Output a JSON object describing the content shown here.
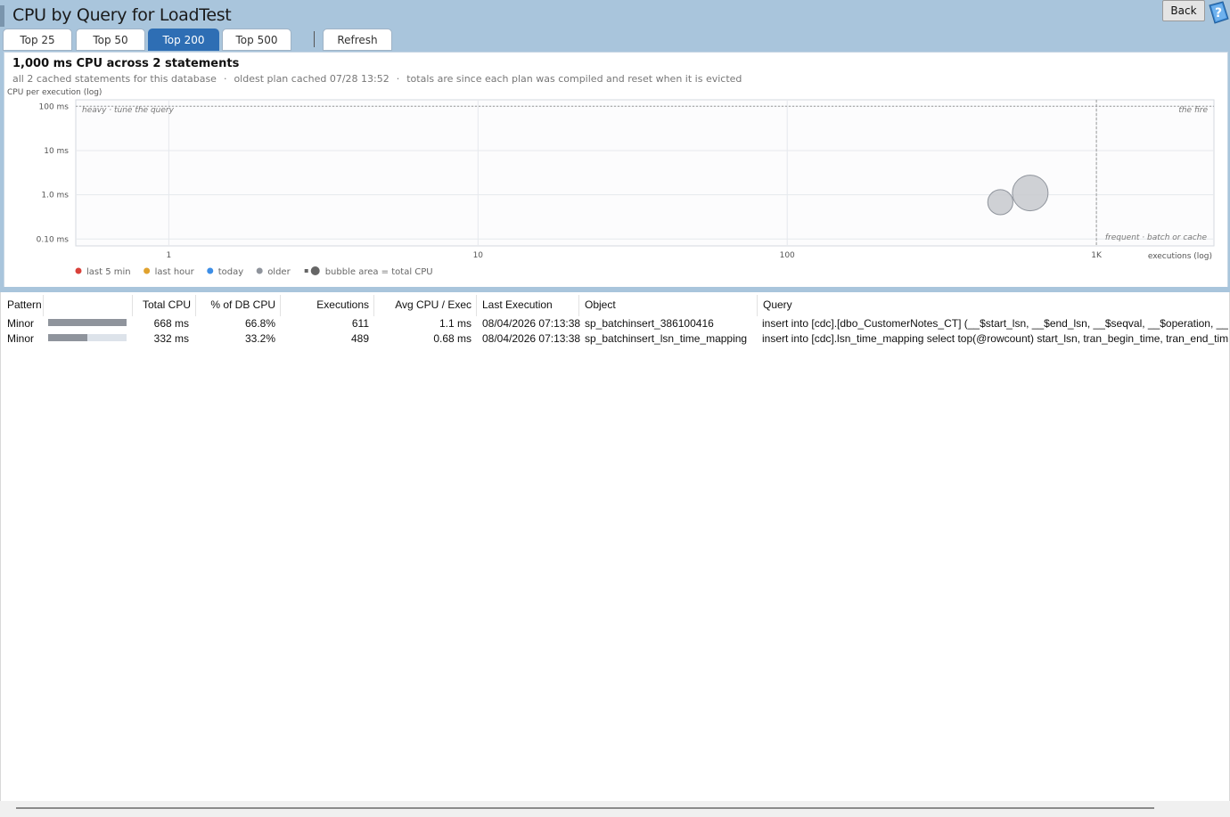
{
  "header": {
    "title": "CPU by Query for LoadTest",
    "back_label": "Back",
    "tabs": [
      {
        "label": "Top 25",
        "active": false
      },
      {
        "label": "Top 50",
        "active": false
      },
      {
        "label": "Top 200",
        "active": true
      },
      {
        "label": "Top 500",
        "active": false
      }
    ],
    "refresh_label": "Refresh"
  },
  "summary": {
    "headline": "1,000 ms CPU across 2 statements",
    "sub_1": "all 2 cached statements for this database",
    "sub_2": "oldest plan cached 07/28 13:52",
    "sub_3": "totals are since each plan was compiled and reset when it is evicted",
    "separator": "·"
  },
  "chart_data": {
    "type": "scatter",
    "ylabel": "CPU per execution (log)",
    "xlabel": "executions (log)",
    "x_scale": "log",
    "y_scale": "log",
    "xlim": [
      0.5,
      2400
    ],
    "ylim": [
      0.07,
      140
    ],
    "x_ticks": [
      {
        "value": 1,
        "label": "1"
      },
      {
        "value": 10,
        "label": "10"
      },
      {
        "value": 100,
        "label": "100"
      },
      {
        "value": 1000,
        "label": "1K"
      }
    ],
    "y_ticks": [
      {
        "value": 100,
        "label": "100 ms"
      },
      {
        "value": 10,
        "label": "10 ms"
      },
      {
        "value": 1,
        "label": "1.0 ms"
      },
      {
        "value": 0.1,
        "label": "0.10 ms"
      }
    ],
    "threshold_y": 100,
    "threshold_x": 1000,
    "zone_labels": {
      "heavy": "heavy · tune the query",
      "fire": "the fire",
      "frequent": "frequent · batch or cache"
    },
    "legend": [
      {
        "label": "last 5 min",
        "color": "#d9413a"
      },
      {
        "label": "last hour",
        "color": "#e0a22e"
      },
      {
        "label": "today",
        "color": "#3d8ee6"
      },
      {
        "label": "older",
        "color": "#8f949c"
      }
    ],
    "size_legend_label": "bubble area = total CPU",
    "points": [
      {
        "name": "sp_batchinsert_386100416",
        "executions": 611,
        "avg_cpu_ms": 1.1,
        "total_cpu_ms": 668,
        "age": "older"
      },
      {
        "name": "sp_batchinsert_lsn_time_mapping",
        "executions": 489,
        "avg_cpu_ms": 0.68,
        "total_cpu_ms": 332,
        "age": "older"
      }
    ]
  },
  "table": {
    "columns": {
      "pattern": "Pattern",
      "total_cpu": "Total CPU",
      "pct_db_cpu": "% of DB CPU",
      "executions": "Executions",
      "avg_cpu": "Avg CPU / Exec",
      "last_execution": "Last Execution",
      "object": "Object",
      "query": "Query"
    },
    "rows": [
      {
        "pattern": "Minor",
        "bar_fraction": 1.0,
        "total_cpu": "668 ms",
        "pct_db_cpu": "66.8%",
        "executions": "611",
        "avg_cpu": "1.1 ms",
        "last_execution": "08/04/2026 07:13:38",
        "object": "sp_batchinsert_386100416",
        "query": "insert into [cdc].[dbo_CustomerNotes_CT] (__$start_lsn, __$end_lsn, __$seqval, __$operation, __$update_mask"
      },
      {
        "pattern": "Minor",
        "bar_fraction": 0.497,
        "total_cpu": "332 ms",
        "pct_db_cpu": "33.2%",
        "executions": "489",
        "avg_cpu": "0.68 ms",
        "last_execution": "08/04/2026 07:13:38",
        "object": "sp_batchinsert_lsn_time_mapping",
        "query": "insert into [cdc].lsn_time_mapping select top(@rowcount) start_lsn, tran_begin_time, tran_end_time, tran_id, tran_begin_lsn"
      }
    ]
  }
}
